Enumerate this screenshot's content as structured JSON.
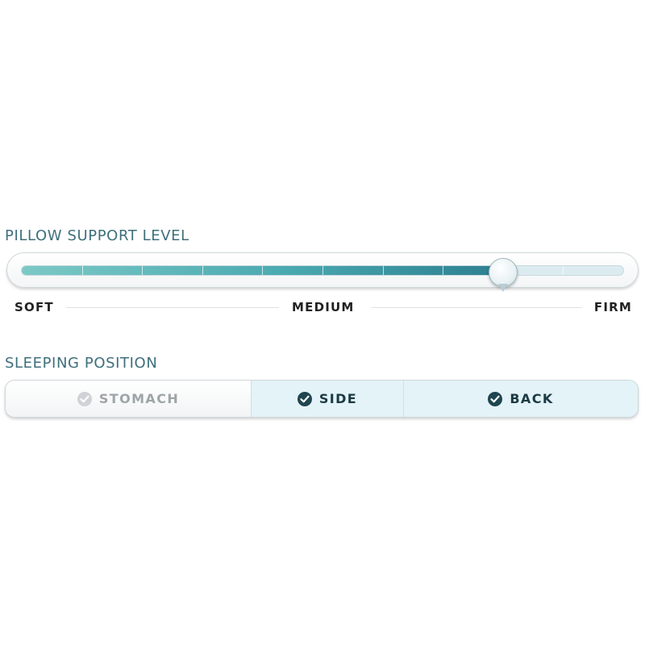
{
  "pillow_support": {
    "title": "PILLOW SUPPORT LEVEL",
    "level": 0.8,
    "segments": 10,
    "scale_labels": [
      "SOFT",
      "MEDIUM",
      "FIRM"
    ]
  },
  "sleeping_position": {
    "title": "SLEEPING POSITION",
    "options": [
      {
        "label": "STOMACH",
        "selected": false
      },
      {
        "label": "SIDE",
        "selected": true
      },
      {
        "label": "BACK",
        "selected": true
      }
    ]
  },
  "icons": {
    "check": "check-circle-icon"
  },
  "colors": {
    "title": "#3f6f7c",
    "fill_start": "#7cc9c6",
    "fill_end": "#2d7f90",
    "selected_bg": "#e3f3f7",
    "check_on": "#1f4550",
    "check_off": "#cfd3d5"
  }
}
